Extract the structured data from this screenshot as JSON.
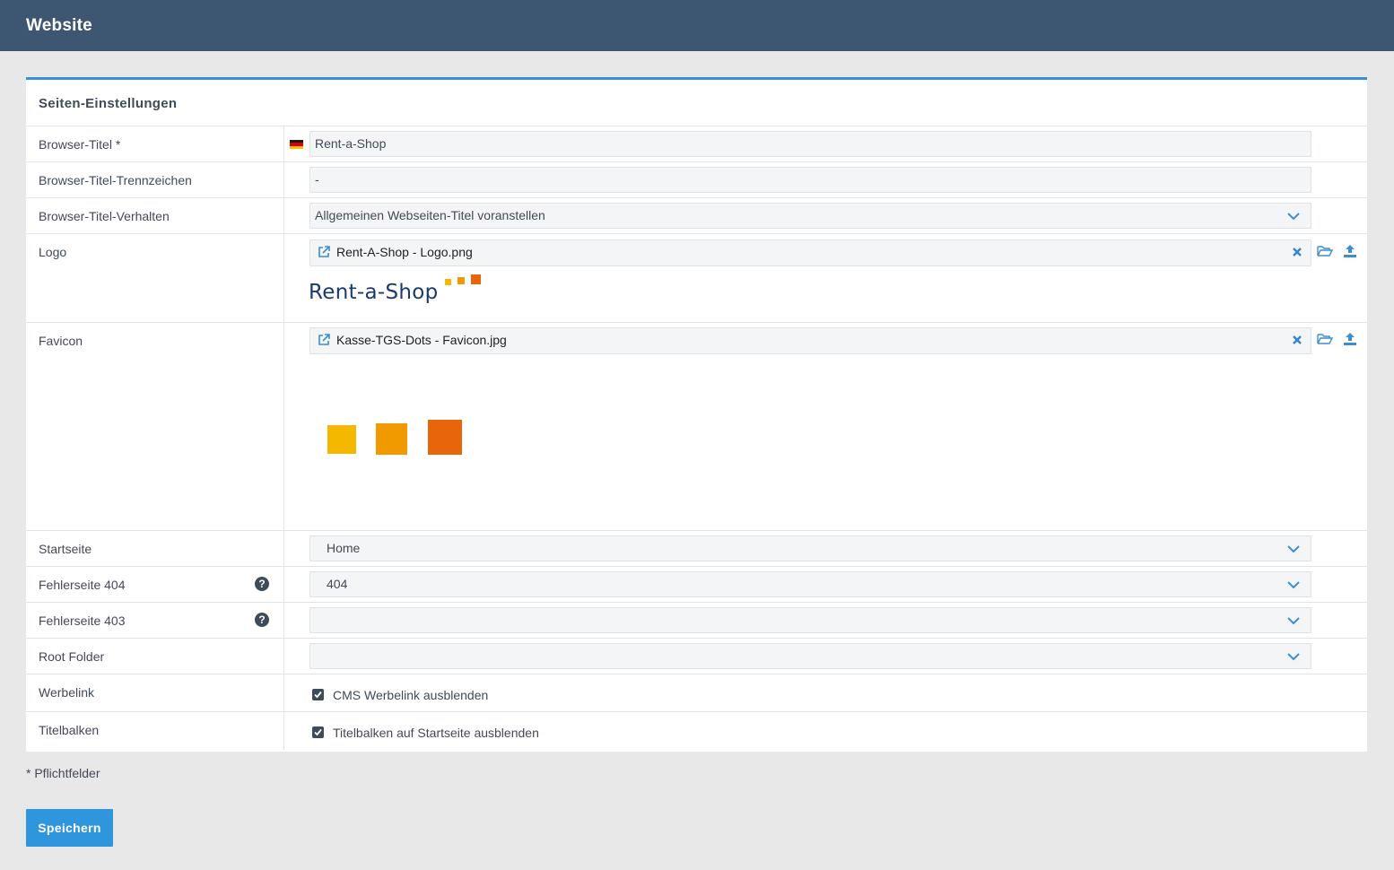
{
  "app": {
    "title": "Website"
  },
  "panel": {
    "title": "Seiten-Einstellungen"
  },
  "fields": {
    "browser_title": {
      "label": "Browser-Titel *",
      "value": "Rent-a-Shop",
      "language": "de"
    },
    "title_separator": {
      "label": "Browser-Titel-Trennzeichen",
      "value": "-"
    },
    "title_behavior": {
      "label": "Browser-Titel-Verhalten",
      "value": "Allgemeinen Webseiten-Titel voranstellen"
    },
    "logo": {
      "label": "Logo",
      "filename": "Rent-A-Shop - Logo.png",
      "preview_text": "Rent-a-Shop"
    },
    "favicon": {
      "label": "Favicon",
      "filename": "Kasse-TGS-Dots - Favicon.jpg"
    },
    "start_page": {
      "label": "Startseite",
      "value": "Home"
    },
    "error_404": {
      "label": "Fehlerseite 404",
      "value": "404"
    },
    "error_403": {
      "label": "Fehlerseite 403",
      "value": ""
    },
    "root_folder": {
      "label": "Root Folder",
      "value": ""
    },
    "ad_link": {
      "label": "Werbelink",
      "checkbox_label": "CMS Werbelink ausblenden",
      "checked": true
    },
    "title_bar": {
      "label": "Titelbalken",
      "checkbox_label": "Titelbalken auf Startseite ausblenden",
      "checked": true
    }
  },
  "footer": {
    "required_note": "* Pflichtfelder",
    "save_label": "Speichern"
  },
  "icons": {
    "help": "question-circle-icon",
    "open_file": "folder-open-icon",
    "upload": "upload-icon",
    "remove": "close-icon",
    "external": "external-link-icon",
    "dropdown": "chevron-down-icon"
  },
  "colors": {
    "topbar": "#3d5671",
    "accent": "#3b8ed0",
    "button": "#2f95dc",
    "logo_blue": "#1a3a6e",
    "dot_yellow": "#f5b800",
    "dot_amber": "#f09a00",
    "dot_orange": "#e8650a"
  }
}
